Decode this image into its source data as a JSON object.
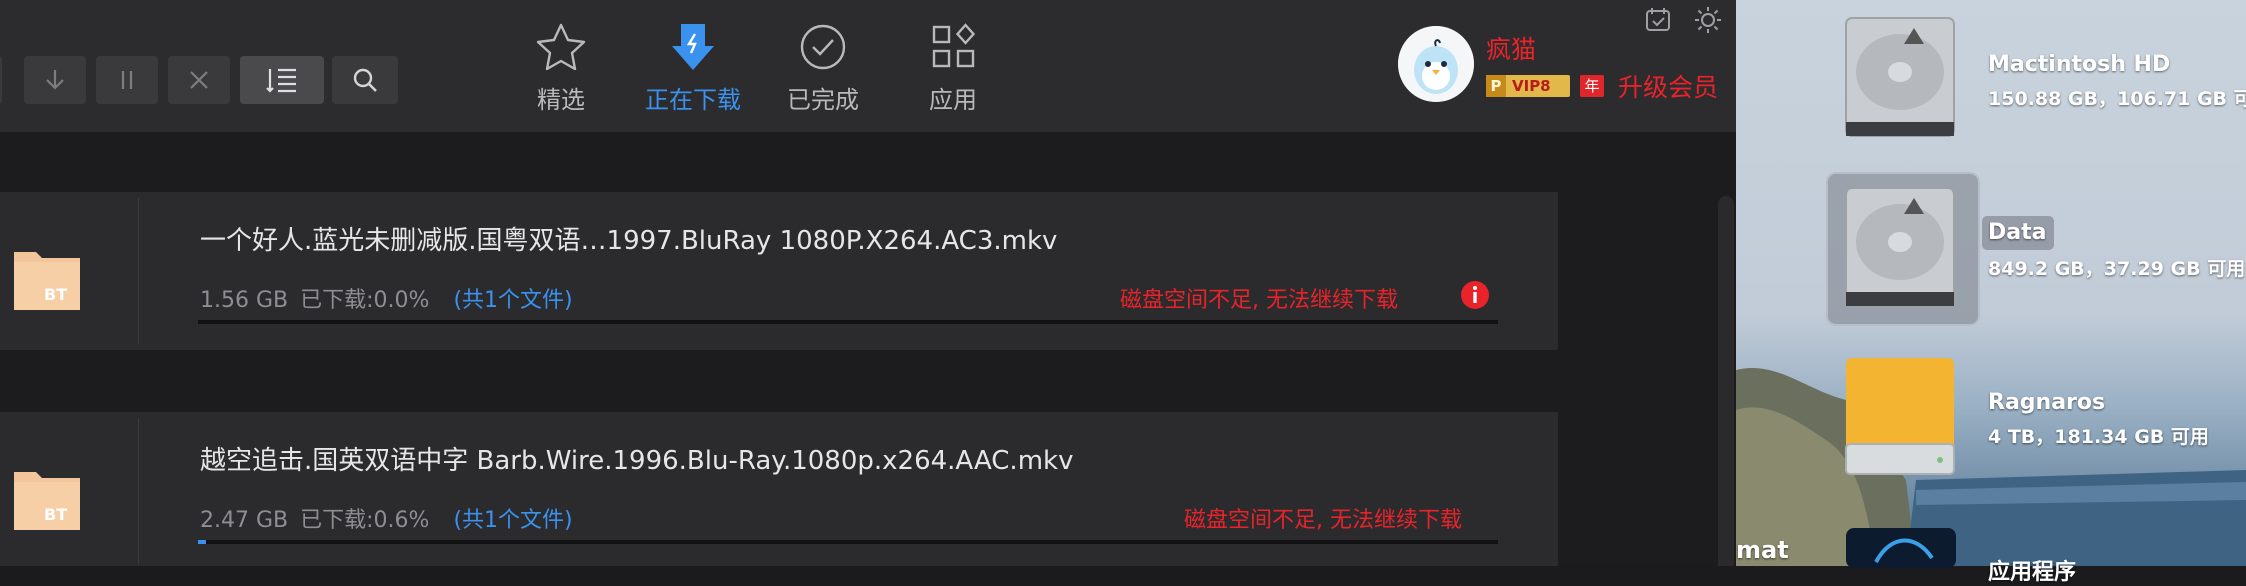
{
  "toolbar": {
    "buttons": [
      "start-icon",
      "download-icon",
      "pause-icon",
      "delete-icon",
      "sort-icon",
      "search-icon"
    ],
    "tabs": [
      {
        "label": "精选",
        "icon": "star-icon"
      },
      {
        "label": "正在下载",
        "icon": "download-arrow-icon",
        "active": true
      },
      {
        "label": "已完成",
        "icon": "check-circle-icon"
      },
      {
        "label": "应用",
        "icon": "apps-grid-icon"
      }
    ],
    "user": {
      "name": "疯猫",
      "vip": "VIP8",
      "vip_prefix": "P",
      "year": "年",
      "upgrade": "升级会员"
    },
    "accent_color": "#3a92ee",
    "error_color": "#e8232a"
  },
  "downloads": [
    {
      "filename": "一个好人.蓝光未删减版.国粤双语…1997.BluRay 1080P.X264.AC3.mkv",
      "size": "1.56 GB",
      "progress_label": "已下载:0.0%",
      "progress": 0.0,
      "files": "(共1个文件)",
      "error": "磁盘空间不足, 无法继续下载",
      "folder_tag": "BT"
    },
    {
      "filename": "越空追击.国英双语中字 Barb.Wire.1996.Blu-Ray.1080p.x264.AAC.mkv",
      "size": "2.47 GB",
      "progress_label": "已下载:0.6%",
      "progress": 0.006,
      "files": "(共1个文件)",
      "error": "磁盘空间不足, 无法继续下载",
      "folder_tag": "BT"
    }
  ],
  "desktop": {
    "drives": [
      {
        "name": "Mactintosh HD",
        "size": "150.88 GB，106.71 GB 可用"
      },
      {
        "name": "Data",
        "size": "849.2 GB，37.29 GB 可用"
      },
      {
        "name": "Ragnaros",
        "size": "4 TB，181.34 GB 可用"
      },
      {
        "name": "应用程序",
        "size": ""
      }
    ],
    "partial_label": "mat"
  }
}
